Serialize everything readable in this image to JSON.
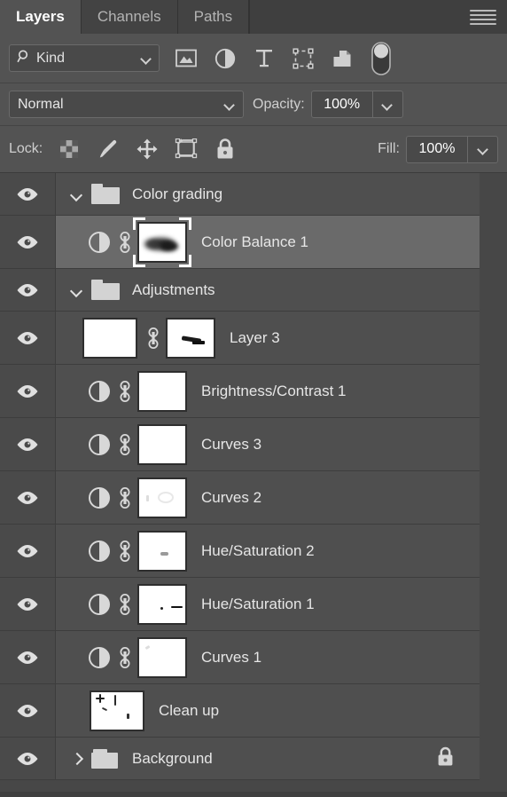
{
  "panel": {
    "tabs": [
      {
        "label": "Layers",
        "active": true
      },
      {
        "label": "Channels",
        "active": false
      },
      {
        "label": "Paths",
        "active": false
      }
    ],
    "menu_icon": "hamburger-menu-icon"
  },
  "filter": {
    "kind_label": "Kind",
    "search_icon": "search-icon",
    "dropdown_icon": "chevron-down-icon",
    "icons": [
      {
        "name": "filter-pixel-layers-icon",
        "title": "Pixel layers"
      },
      {
        "name": "filter-adjustment-layers-icon",
        "title": "Adjustment layers"
      },
      {
        "name": "filter-type-layers-icon",
        "title": "Type layers"
      },
      {
        "name": "filter-shape-layers-icon",
        "title": "Shape layers"
      },
      {
        "name": "filter-smart-object-layers-icon",
        "title": "Smart objects"
      },
      {
        "name": "filter-toggle-switch",
        "title": "Turn filtering on/off"
      }
    ]
  },
  "blend": {
    "mode": "Normal",
    "opacity_label": "Opacity:",
    "opacity_value": "100%",
    "fill_label": "Fill:",
    "fill_value": "100%"
  },
  "lock": {
    "label": "Lock:",
    "icons": [
      {
        "name": "lock-transparent-pixels-icon"
      },
      {
        "name": "lock-image-pixels-brush-icon"
      },
      {
        "name": "lock-position-move-icon"
      },
      {
        "name": "lock-artboard-nesting-icon"
      },
      {
        "name": "lock-all-icon"
      }
    ]
  },
  "layers": [
    {
      "name": "Color grading",
      "type": "group",
      "expanded": true,
      "visible": true,
      "selected": false,
      "locked": false,
      "thumb": "folder"
    },
    {
      "name": "Color Balance 1",
      "type": "adjustment",
      "visible": true,
      "selected": true,
      "locked": false,
      "thumb": "adjustment",
      "mask": "dark-blob-on-white",
      "mask_selected": true,
      "linked": true
    },
    {
      "name": "Adjustments",
      "type": "group",
      "expanded": true,
      "visible": true,
      "selected": false,
      "locked": false,
      "thumb": "folder"
    },
    {
      "name": "Layer 3",
      "type": "pixel",
      "visible": true,
      "selected": false,
      "locked": false,
      "thumb": "gray-pixels",
      "mask": "small-dark-stroke-on-white",
      "mask_selected": false,
      "linked": true
    },
    {
      "name": "Brightness/Contrast 1",
      "type": "adjustment",
      "visible": true,
      "selected": false,
      "locked": false,
      "thumb": "adjustment",
      "mask": "black-top-white-bottom",
      "mask_selected": false,
      "linked": true
    },
    {
      "name": "Curves 3",
      "type": "adjustment",
      "visible": true,
      "selected": false,
      "locked": false,
      "thumb": "adjustment",
      "mask": "all-white",
      "mask_selected": false,
      "linked": true
    },
    {
      "name": "Curves 2",
      "type": "adjustment",
      "visible": true,
      "selected": false,
      "locked": false,
      "thumb": "adjustment",
      "mask": "black-with-small-white-marks",
      "mask_selected": false,
      "linked": true
    },
    {
      "name": "Hue/Saturation 2",
      "type": "adjustment",
      "visible": true,
      "selected": false,
      "locked": false,
      "thumb": "adjustment",
      "mask": "white-blob-on-black",
      "mask_selected": false,
      "linked": true
    },
    {
      "name": "Hue/Saturation 1",
      "type": "adjustment",
      "visible": true,
      "selected": false,
      "locked": false,
      "thumb": "adjustment",
      "mask": "white-with-small-dark-marks",
      "mask_selected": false,
      "linked": true
    },
    {
      "name": "Curves 1",
      "type": "adjustment",
      "visible": true,
      "selected": false,
      "locked": false,
      "thumb": "adjustment",
      "mask": "black-with-tiny-white-mark",
      "mask_selected": false,
      "linked": true
    },
    {
      "name": "Clean up",
      "type": "pixel",
      "visible": true,
      "selected": false,
      "locked": false,
      "thumb": "transparent-checker-with-marks",
      "linked": false
    },
    {
      "name": "Background",
      "type": "group",
      "expanded": false,
      "visible": true,
      "selected": false,
      "locked": true,
      "thumb": "folder",
      "lock_icon": "lock-icon"
    }
  ],
  "colors": {
    "panel_bg": "#535353",
    "list_bg": "#474747",
    "row_bg": "#4f4f4f",
    "row_selected_bg": "#6a6a6a",
    "eye_column_bg": "#4a4a4a",
    "text": "#e6e6e6",
    "tab_active_bg": "#535353",
    "field_bg": "#494949",
    "field_border": "#6a6a6a"
  }
}
